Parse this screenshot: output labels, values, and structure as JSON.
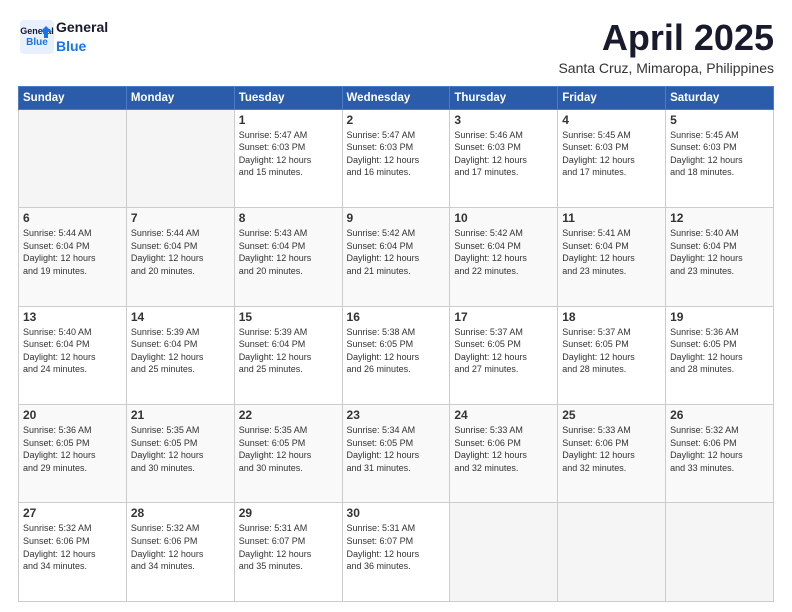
{
  "header": {
    "logo_line1": "General",
    "logo_line2": "Blue",
    "month_year": "April 2025",
    "location": "Santa Cruz, Mimaropa, Philippines"
  },
  "days_of_week": [
    "Sunday",
    "Monday",
    "Tuesday",
    "Wednesday",
    "Thursday",
    "Friday",
    "Saturday"
  ],
  "weeks": [
    [
      {
        "day": "",
        "info": ""
      },
      {
        "day": "",
        "info": ""
      },
      {
        "day": "1",
        "info": "Sunrise: 5:47 AM\nSunset: 6:03 PM\nDaylight: 12 hours\nand 15 minutes."
      },
      {
        "day": "2",
        "info": "Sunrise: 5:47 AM\nSunset: 6:03 PM\nDaylight: 12 hours\nand 16 minutes."
      },
      {
        "day": "3",
        "info": "Sunrise: 5:46 AM\nSunset: 6:03 PM\nDaylight: 12 hours\nand 17 minutes."
      },
      {
        "day": "4",
        "info": "Sunrise: 5:45 AM\nSunset: 6:03 PM\nDaylight: 12 hours\nand 17 minutes."
      },
      {
        "day": "5",
        "info": "Sunrise: 5:45 AM\nSunset: 6:03 PM\nDaylight: 12 hours\nand 18 minutes."
      }
    ],
    [
      {
        "day": "6",
        "info": "Sunrise: 5:44 AM\nSunset: 6:04 PM\nDaylight: 12 hours\nand 19 minutes."
      },
      {
        "day": "7",
        "info": "Sunrise: 5:44 AM\nSunset: 6:04 PM\nDaylight: 12 hours\nand 20 minutes."
      },
      {
        "day": "8",
        "info": "Sunrise: 5:43 AM\nSunset: 6:04 PM\nDaylight: 12 hours\nand 20 minutes."
      },
      {
        "day": "9",
        "info": "Sunrise: 5:42 AM\nSunset: 6:04 PM\nDaylight: 12 hours\nand 21 minutes."
      },
      {
        "day": "10",
        "info": "Sunrise: 5:42 AM\nSunset: 6:04 PM\nDaylight: 12 hours\nand 22 minutes."
      },
      {
        "day": "11",
        "info": "Sunrise: 5:41 AM\nSunset: 6:04 PM\nDaylight: 12 hours\nand 23 minutes."
      },
      {
        "day": "12",
        "info": "Sunrise: 5:40 AM\nSunset: 6:04 PM\nDaylight: 12 hours\nand 23 minutes."
      }
    ],
    [
      {
        "day": "13",
        "info": "Sunrise: 5:40 AM\nSunset: 6:04 PM\nDaylight: 12 hours\nand 24 minutes."
      },
      {
        "day": "14",
        "info": "Sunrise: 5:39 AM\nSunset: 6:04 PM\nDaylight: 12 hours\nand 25 minutes."
      },
      {
        "day": "15",
        "info": "Sunrise: 5:39 AM\nSunset: 6:04 PM\nDaylight: 12 hours\nand 25 minutes."
      },
      {
        "day": "16",
        "info": "Sunrise: 5:38 AM\nSunset: 6:05 PM\nDaylight: 12 hours\nand 26 minutes."
      },
      {
        "day": "17",
        "info": "Sunrise: 5:37 AM\nSunset: 6:05 PM\nDaylight: 12 hours\nand 27 minutes."
      },
      {
        "day": "18",
        "info": "Sunrise: 5:37 AM\nSunset: 6:05 PM\nDaylight: 12 hours\nand 28 minutes."
      },
      {
        "day": "19",
        "info": "Sunrise: 5:36 AM\nSunset: 6:05 PM\nDaylight: 12 hours\nand 28 minutes."
      }
    ],
    [
      {
        "day": "20",
        "info": "Sunrise: 5:36 AM\nSunset: 6:05 PM\nDaylight: 12 hours\nand 29 minutes."
      },
      {
        "day": "21",
        "info": "Sunrise: 5:35 AM\nSunset: 6:05 PM\nDaylight: 12 hours\nand 30 minutes."
      },
      {
        "day": "22",
        "info": "Sunrise: 5:35 AM\nSunset: 6:05 PM\nDaylight: 12 hours\nand 30 minutes."
      },
      {
        "day": "23",
        "info": "Sunrise: 5:34 AM\nSunset: 6:05 PM\nDaylight: 12 hours\nand 31 minutes."
      },
      {
        "day": "24",
        "info": "Sunrise: 5:33 AM\nSunset: 6:06 PM\nDaylight: 12 hours\nand 32 minutes."
      },
      {
        "day": "25",
        "info": "Sunrise: 5:33 AM\nSunset: 6:06 PM\nDaylight: 12 hours\nand 32 minutes."
      },
      {
        "day": "26",
        "info": "Sunrise: 5:32 AM\nSunset: 6:06 PM\nDaylight: 12 hours\nand 33 minutes."
      }
    ],
    [
      {
        "day": "27",
        "info": "Sunrise: 5:32 AM\nSunset: 6:06 PM\nDaylight: 12 hours\nand 34 minutes."
      },
      {
        "day": "28",
        "info": "Sunrise: 5:32 AM\nSunset: 6:06 PM\nDaylight: 12 hours\nand 34 minutes."
      },
      {
        "day": "29",
        "info": "Sunrise: 5:31 AM\nSunset: 6:07 PM\nDaylight: 12 hours\nand 35 minutes."
      },
      {
        "day": "30",
        "info": "Sunrise: 5:31 AM\nSunset: 6:07 PM\nDaylight: 12 hours\nand 36 minutes."
      },
      {
        "day": "",
        "info": ""
      },
      {
        "day": "",
        "info": ""
      },
      {
        "day": "",
        "info": ""
      }
    ]
  ]
}
